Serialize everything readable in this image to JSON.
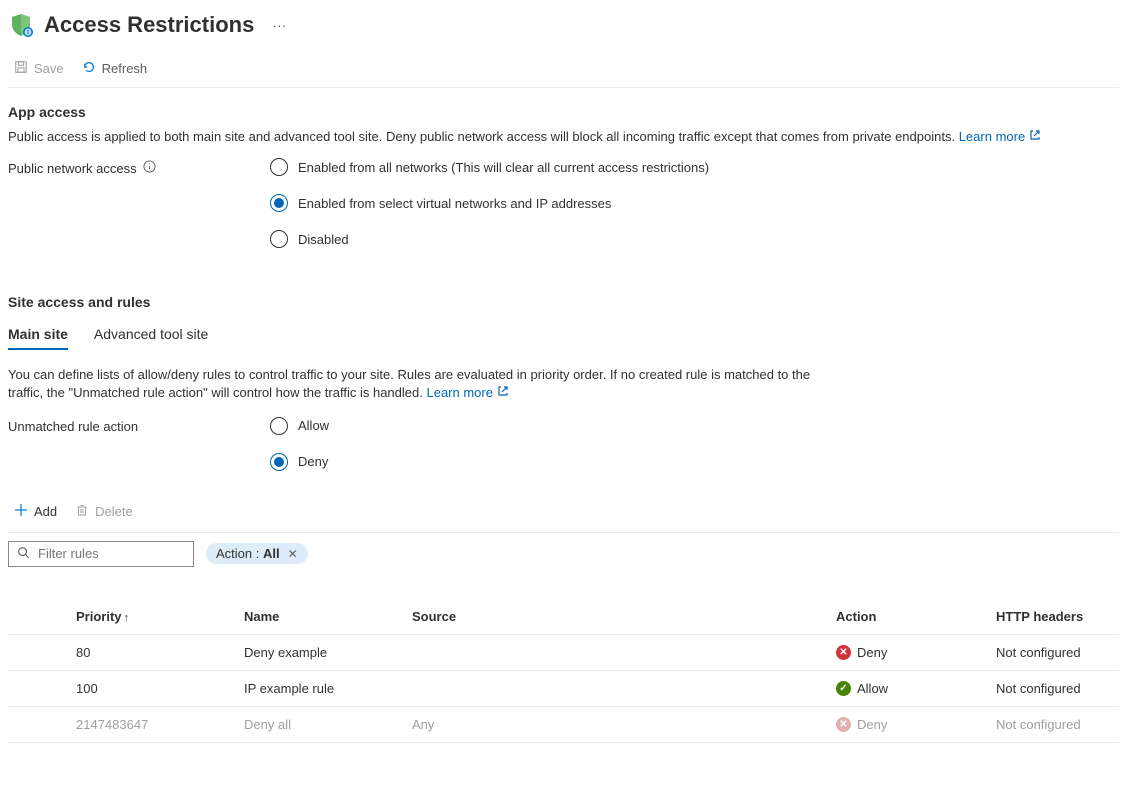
{
  "header": {
    "title": "Access Restrictions",
    "more": "···"
  },
  "toolbar": {
    "save_label": "Save",
    "refresh_label": "Refresh"
  },
  "app_access": {
    "title": "App access",
    "description": "Public access is applied to both main site and advanced tool site. Deny public network access will block all incoming traffic except that comes from private endpoints.",
    "learn_more": "Learn more",
    "field_label": "Public network access",
    "options": {
      "opt0": "Enabled from all networks (This will clear all current access restrictions)",
      "opt1": "Enabled from select virtual networks and IP addresses",
      "opt2": "Disabled"
    }
  },
  "site_access": {
    "title": "Site access and rules",
    "tabs": {
      "main": "Main site",
      "advanced": "Advanced tool site"
    },
    "description": "You can define lists of allow/deny rules to control traffic to your site. Rules are evaluated in priority order. If no created rule is matched to the traffic, the \"Unmatched rule action\" will control how the traffic is handled.",
    "learn_more": "Learn more",
    "unmatched_label": "Unmatched rule action",
    "unmatched_options": {
      "allow": "Allow",
      "deny": "Deny"
    }
  },
  "actions": {
    "add_label": "Add",
    "delete_label": "Delete"
  },
  "filter": {
    "placeholder": "Filter rules",
    "chip_prefix": "Action : ",
    "chip_value": "All"
  },
  "table": {
    "headers": {
      "priority": "Priority",
      "name": "Name",
      "source": "Source",
      "action": "Action",
      "http": "HTTP headers"
    },
    "rows": [
      {
        "priority": "80",
        "name": "Deny example",
        "source": "",
        "action": "Deny",
        "action_type": "deny",
        "http": "Not configured",
        "muted": false
      },
      {
        "priority": "100",
        "name": "IP example rule",
        "source": "",
        "action": "Allow",
        "action_type": "allow",
        "http": "Not configured",
        "muted": false
      },
      {
        "priority": "2147483647",
        "name": "Deny all",
        "source": "Any",
        "action": "Deny",
        "action_type": "deny",
        "http": "Not configured",
        "muted": true
      }
    ]
  }
}
